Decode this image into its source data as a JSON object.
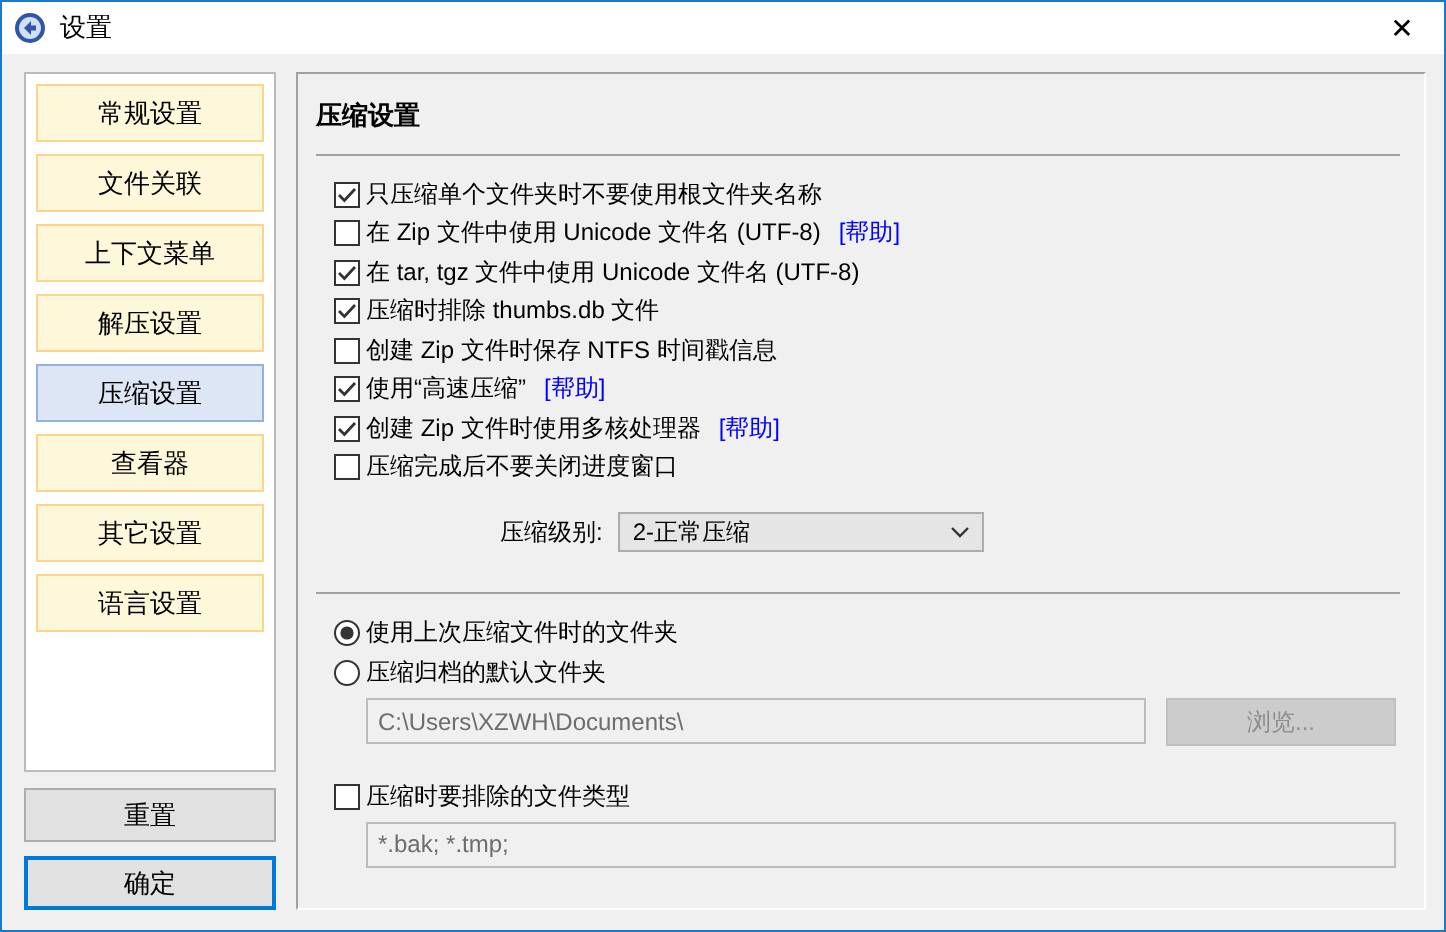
{
  "window": {
    "title": "设置",
    "close": "✕"
  },
  "sidebar": {
    "items": [
      {
        "label": "常规设置",
        "selected": false
      },
      {
        "label": "文件关联",
        "selected": false
      },
      {
        "label": "上下文菜单",
        "selected": false
      },
      {
        "label": "解压设置",
        "selected": false
      },
      {
        "label": "压缩设置",
        "selected": true
      },
      {
        "label": "查看器",
        "selected": false
      },
      {
        "label": "其它设置",
        "selected": false
      },
      {
        "label": "语言设置",
        "selected": false
      }
    ]
  },
  "buttons": [
    {
      "label": "重置",
      "default": false
    },
    {
      "label": "确定",
      "default": true
    }
  ],
  "panel": {
    "title": "压缩设置",
    "options": [
      {
        "label": "只压缩单个文件夹时不要使用根文件夹名称",
        "checked": true
      },
      {
        "label": "在 Zip 文件中使用 Unicode 文件名 (UTF-8)",
        "checked": false,
        "help": "[帮助]"
      },
      {
        "label": "在 tar, tgz 文件中使用 Unicode 文件名 (UTF-8)",
        "checked": true
      },
      {
        "label": "压缩时排除 thumbs.db 文件",
        "checked": true
      },
      {
        "label": "创建 Zip 文件时保存 NTFS 时间戳信息",
        "checked": false
      },
      {
        "label": "使用“高速压缩”",
        "checked": true,
        "help": "[帮助]"
      },
      {
        "label": "创建 Zip 文件时使用多核处理器",
        "checked": true,
        "help": "[帮助]"
      },
      {
        "label": "压缩完成后不要关闭进度窗口",
        "checked": false
      }
    ],
    "level": {
      "label": "压缩级别:",
      "value": "2-正常压缩"
    },
    "folder_options": [
      {
        "label": "使用上次压缩文件时的文件夹",
        "selected": true
      },
      {
        "label": "压缩归档的默认文件夹",
        "selected": false
      }
    ],
    "path_field": {
      "value": "C:\\Users\\XZWH\\Documents\\",
      "disabled": true
    },
    "browse_button": {
      "label": "浏览...",
      "disabled": true
    },
    "exclude": {
      "label": "压缩时要排除的文件类型",
      "checked": false,
      "value": "*.bak; *.tmp;",
      "disabled": true
    }
  }
}
